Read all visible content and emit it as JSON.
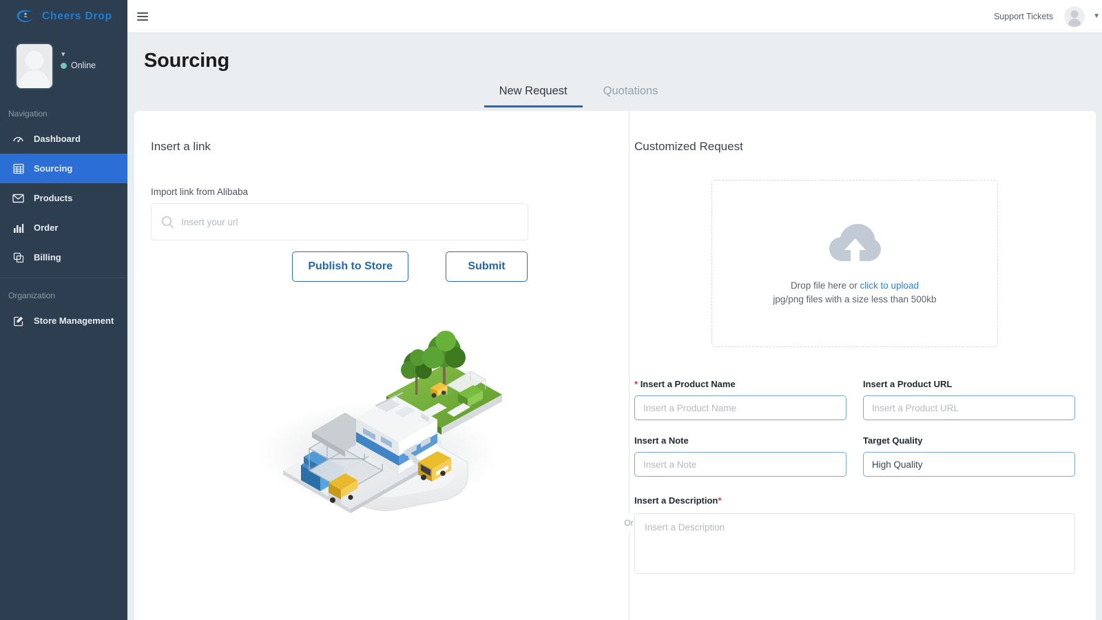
{
  "brand": {
    "name": "Cheers Drop",
    "logo_icon": "circle-swoosh-logo-icon"
  },
  "sidebar": {
    "profile": {
      "status_label": "Online",
      "status_color": "#6fc7bd",
      "avatar_icon": "user-avatar-placeholder-icon",
      "caret_icon": "chevron-down-icon"
    },
    "sections": [
      {
        "title": "Navigation",
        "items": [
          {
            "label": "Dashboard",
            "icon": "dashboard-gauge-icon",
            "active": false
          },
          {
            "label": "Sourcing",
            "icon": "grid-table-icon",
            "active": true
          },
          {
            "label": "Products",
            "icon": "envelope-icon",
            "active": false
          },
          {
            "label": "Order",
            "icon": "bar-chart-icon",
            "active": false
          },
          {
            "label": "Billing",
            "icon": "copy-documents-icon",
            "active": false
          }
        ]
      },
      {
        "title": "Organization",
        "items": [
          {
            "label": "Store Management",
            "icon": "edit-square-icon",
            "active": false
          }
        ]
      }
    ]
  },
  "topbar": {
    "menu_icon": "hamburger-menu-icon",
    "support_label": "Support Tickets",
    "avatar_icon": "user-avatar-icon",
    "caret_icon": "caret-down-icon"
  },
  "page": {
    "title": "Sourcing",
    "tabs": [
      {
        "label": "New Request",
        "active": true
      },
      {
        "label": "Quotations",
        "active": false
      }
    ]
  },
  "left_panel": {
    "heading": "Insert a link",
    "import_label": "Import link from Alibaba",
    "url_placeholder": "Insert your url",
    "url_value": "",
    "search_icon": "search-icon",
    "publish_label": "Publish to Store",
    "submit_label": "Submit",
    "illustration_icon": "isometric-logistics-warehouse-illustration"
  },
  "divider": {
    "or_label": "Or"
  },
  "right_panel": {
    "heading": "Customized Request",
    "dropzone": {
      "icon": "cloud-upload-icon",
      "text_prefix": "Drop file here or ",
      "link_label": "click to upload",
      "hint": "jpg/png files with a size less than 500kb"
    },
    "fields": {
      "product_name": {
        "label": "Insert a Product Name",
        "required": true,
        "required_prefix": true,
        "placeholder": "Insert a Product Name",
        "value": ""
      },
      "product_url": {
        "label": "Insert a Product URL",
        "required": false,
        "placeholder": "Insert a Product URL",
        "value": ""
      },
      "note": {
        "label": "Insert a Note",
        "required": false,
        "placeholder": "Insert a Note",
        "value": ""
      },
      "target_quality": {
        "label": "Target Quality",
        "required": false,
        "placeholder": "High Quality",
        "value": "High Quality"
      },
      "description": {
        "label": "Insert a Description",
        "required": true,
        "placeholder": "Insert a Description",
        "value": ""
      }
    }
  },
  "colors": {
    "sidebar_bg": "#2c3e50",
    "sidebar_active": "#2b6fd6",
    "brand_blue": "#1a7fd4",
    "accent_blue": "#2b6cb0",
    "tab_underline": "#2766b8",
    "page_bg": "#eaeef1",
    "required_red": "#e53935",
    "status_green": "#6fc7bd"
  }
}
